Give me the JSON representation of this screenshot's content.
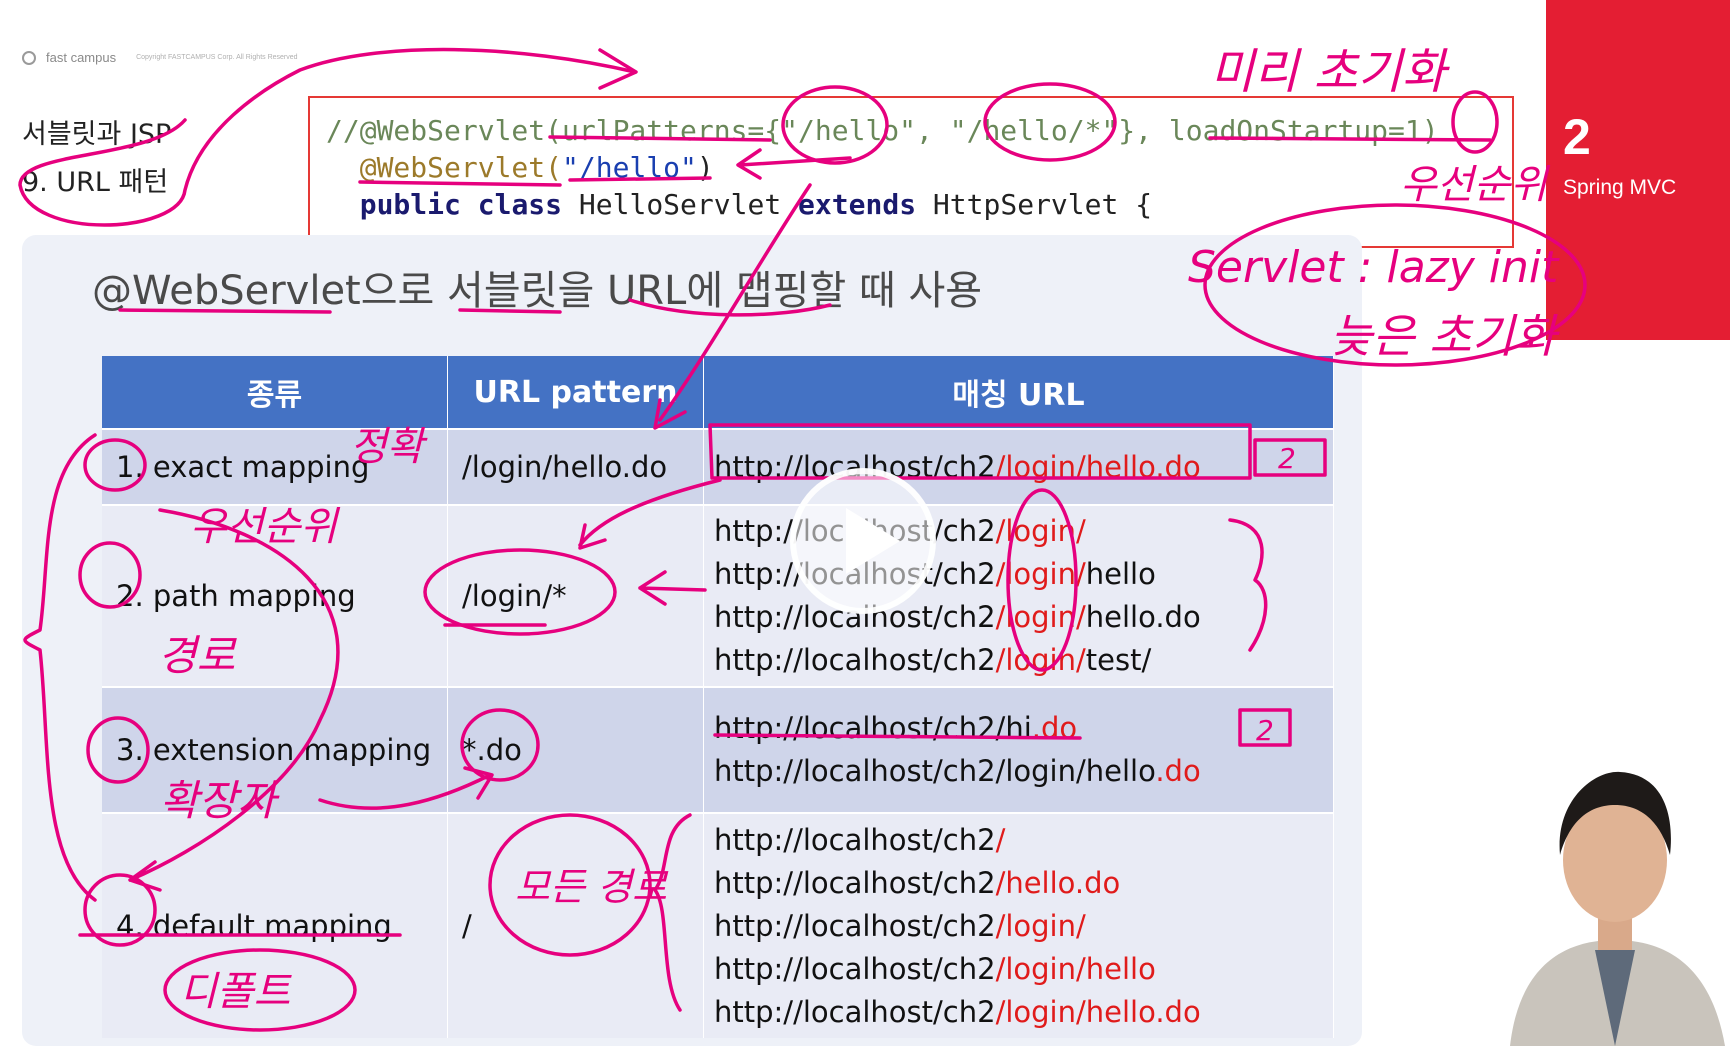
{
  "brand": {
    "logo_text": "fast campus",
    "copyright": "Copyright FASTCAMPUS Corp. All Rights Reserved"
  },
  "breadcrumb": {
    "section": "서블릿과 JSP",
    "topic": "9. URL 패턴"
  },
  "code": {
    "line1": "//@WebServlet(urlPatterns={\"/hello\", \"/hello/*\"}, loadOnStartup=1)",
    "line2_annotation": "@WebServlet(",
    "line2_string": "\"/hello\"",
    "line2_close": ")",
    "line3_kw1": "public",
    "line3_kw2": "class",
    "line3_name": "HelloServlet",
    "line3_kw3": "extends",
    "line3_rest": "HttpServlet {"
  },
  "subtitle": "@WebServlet으로 서블릿을 URL에 맵핑할 때 사용",
  "table": {
    "headers": [
      "종류",
      "URL pattern",
      "매칭 URL"
    ],
    "rows": [
      {
        "kind": "1. exact mapping",
        "pattern": "/login/hello.do",
        "urls": [
          {
            "base": "http://localhost/ch2",
            "match": "/login/hello.do",
            "rest": ""
          }
        ]
      },
      {
        "kind": "2. path mapping",
        "pattern": "/login/*",
        "urls": [
          {
            "base": "http://localhost/ch2",
            "match": "/login/",
            "rest": ""
          },
          {
            "base": "http://localhost/ch2",
            "match": "/login/",
            "rest": "hello"
          },
          {
            "base": "http://localhost/ch2",
            "match": "/login/",
            "rest": "hello.do"
          },
          {
            "base": "http://localhost/ch2",
            "match": "/login/",
            "rest": "test/"
          }
        ]
      },
      {
        "kind": "3. extension mapping",
        "pattern": "*.do",
        "urls": [
          {
            "base": "http://localhost/ch2/hi",
            "match": ".do",
            "rest": ""
          },
          {
            "base": "http://localhost/ch2/login/hello",
            "match": ".do",
            "rest": ""
          }
        ]
      },
      {
        "kind": "4. default mapping",
        "pattern": "/",
        "urls": [
          {
            "base": "http://localhost/ch2",
            "match": "/",
            "rest": ""
          },
          {
            "base": "http://localhost/ch2",
            "match": "/hello.do",
            "rest": ""
          },
          {
            "base": "http://localhost/ch2",
            "match": "/login/",
            "rest": ""
          },
          {
            "base": "http://localhost/ch2",
            "match": "/login/hello",
            "rest": ""
          },
          {
            "base": "http://localhost/ch2",
            "match": "/login/hello.do",
            "rest": ""
          }
        ]
      }
    ]
  },
  "chapter": {
    "number": "2",
    "title": "Spring MVC"
  },
  "handwriting": {
    "early_init": "미리 초기화",
    "priority_top": "우선순위",
    "servlet_lazy": "Servlet : lazy init",
    "late_init": "늦은 초기화",
    "exact": "정확",
    "priority_left": "우선순위",
    "path": "경로",
    "extension": "확장자",
    "default": "디폴트",
    "all": "모든 경로",
    "box1": "2",
    "box2": "2"
  },
  "colors": {
    "accent_red": "#e41e33",
    "table_header": "#4472c4",
    "highlight": "#e01b1b",
    "ink": "#e6007e"
  },
  "video": {
    "play_icon": "play-icon"
  }
}
